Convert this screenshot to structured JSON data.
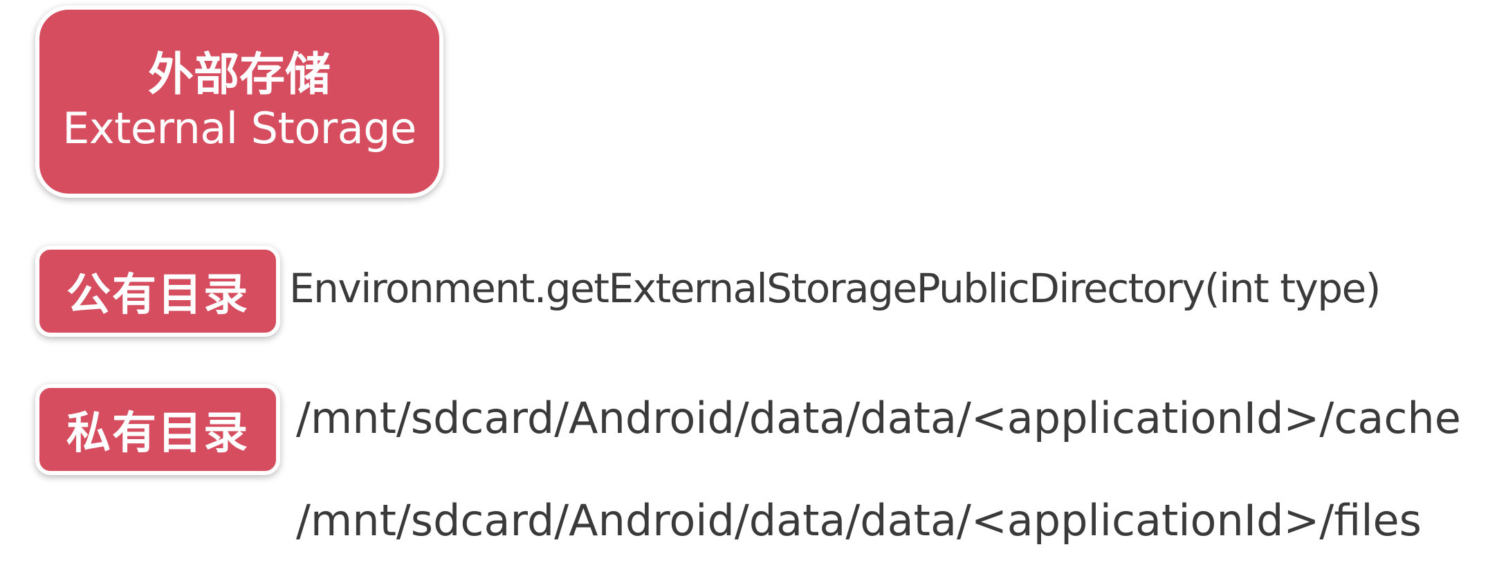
{
  "main": {
    "title_zh": "外部存储",
    "title_en": "External Storage"
  },
  "public": {
    "label": "公有目录",
    "api": "Environment.getExternalStoragePublicDirectory(int type)"
  },
  "private": {
    "label": "私有目录",
    "cache_path": "/mnt/sdcard/Android/data/data/<applicationId>/cache",
    "files_path": "/mnt/sdcard/Android/data/data/<applicationId>/files"
  },
  "colors": {
    "badge": "#d54d5e",
    "text": "#3a3a3a"
  }
}
